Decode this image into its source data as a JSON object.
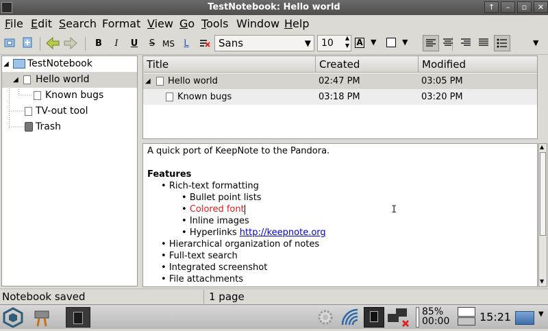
{
  "window": {
    "title": "TestNotebook: Hello world"
  },
  "menus": [
    {
      "label": "File",
      "u": "F",
      "rest": "ile"
    },
    {
      "label": "Edit",
      "u": "E",
      "rest": "dit"
    },
    {
      "label": "Search",
      "u": "S",
      "rest": "earch"
    },
    {
      "label": "Format",
      "u": "",
      "rest": "Format"
    },
    {
      "label": "View",
      "u": "V",
      "rest": "iew"
    },
    {
      "label": "Go",
      "u": "G",
      "rest": "o"
    },
    {
      "label": "Tools",
      "u": "T",
      "rest": "ools"
    },
    {
      "label": "Window",
      "u": "",
      "rest": "Window"
    },
    {
      "label": "Help",
      "u": "H",
      "rest": "elp"
    }
  ],
  "toolbar": {
    "bold": "B",
    "italic": "I",
    "underline": "U",
    "strike": "S",
    "mono": "MS",
    "link": "L",
    "font_family": "Sans",
    "font_size": "10"
  },
  "tree": {
    "notebook": "TestNotebook",
    "items": [
      "Hello world",
      "Known bugs",
      "TV-out tool",
      "Trash"
    ]
  },
  "list": {
    "columns": [
      "Title",
      "Created",
      "Modified"
    ],
    "rows": [
      {
        "title": "Hello world",
        "created": "02:47 PM",
        "modified": "03:05 PM"
      },
      {
        "title": "Known bugs",
        "created": "03:18 PM",
        "modified": "03:20 PM"
      }
    ]
  },
  "editor": {
    "intro": "A quick port of KeepNote to the Pandora.",
    "features_heading": "Features",
    "b1": "Rich-text formatting",
    "b1a": "Bullet point lists",
    "b1b": "Colored font",
    "b1c": "Inline images",
    "b1d_text": "Hyperlinks ",
    "b1d_link": "http://keepnote.org",
    "b2": "Hierarchical organization of notes",
    "b3": "Full-text search",
    "b4": "Integrated screenshot",
    "b5": "File attachments",
    "bullet": "•",
    "colored_font_color": "#e01b1b",
    "link_color": "#0000cc"
  },
  "status": {
    "left": "Notebook saved",
    "right": "1 page"
  },
  "taskbar": {
    "battery": "85%",
    "battery_time": "00:00",
    "clock": "15:21"
  }
}
